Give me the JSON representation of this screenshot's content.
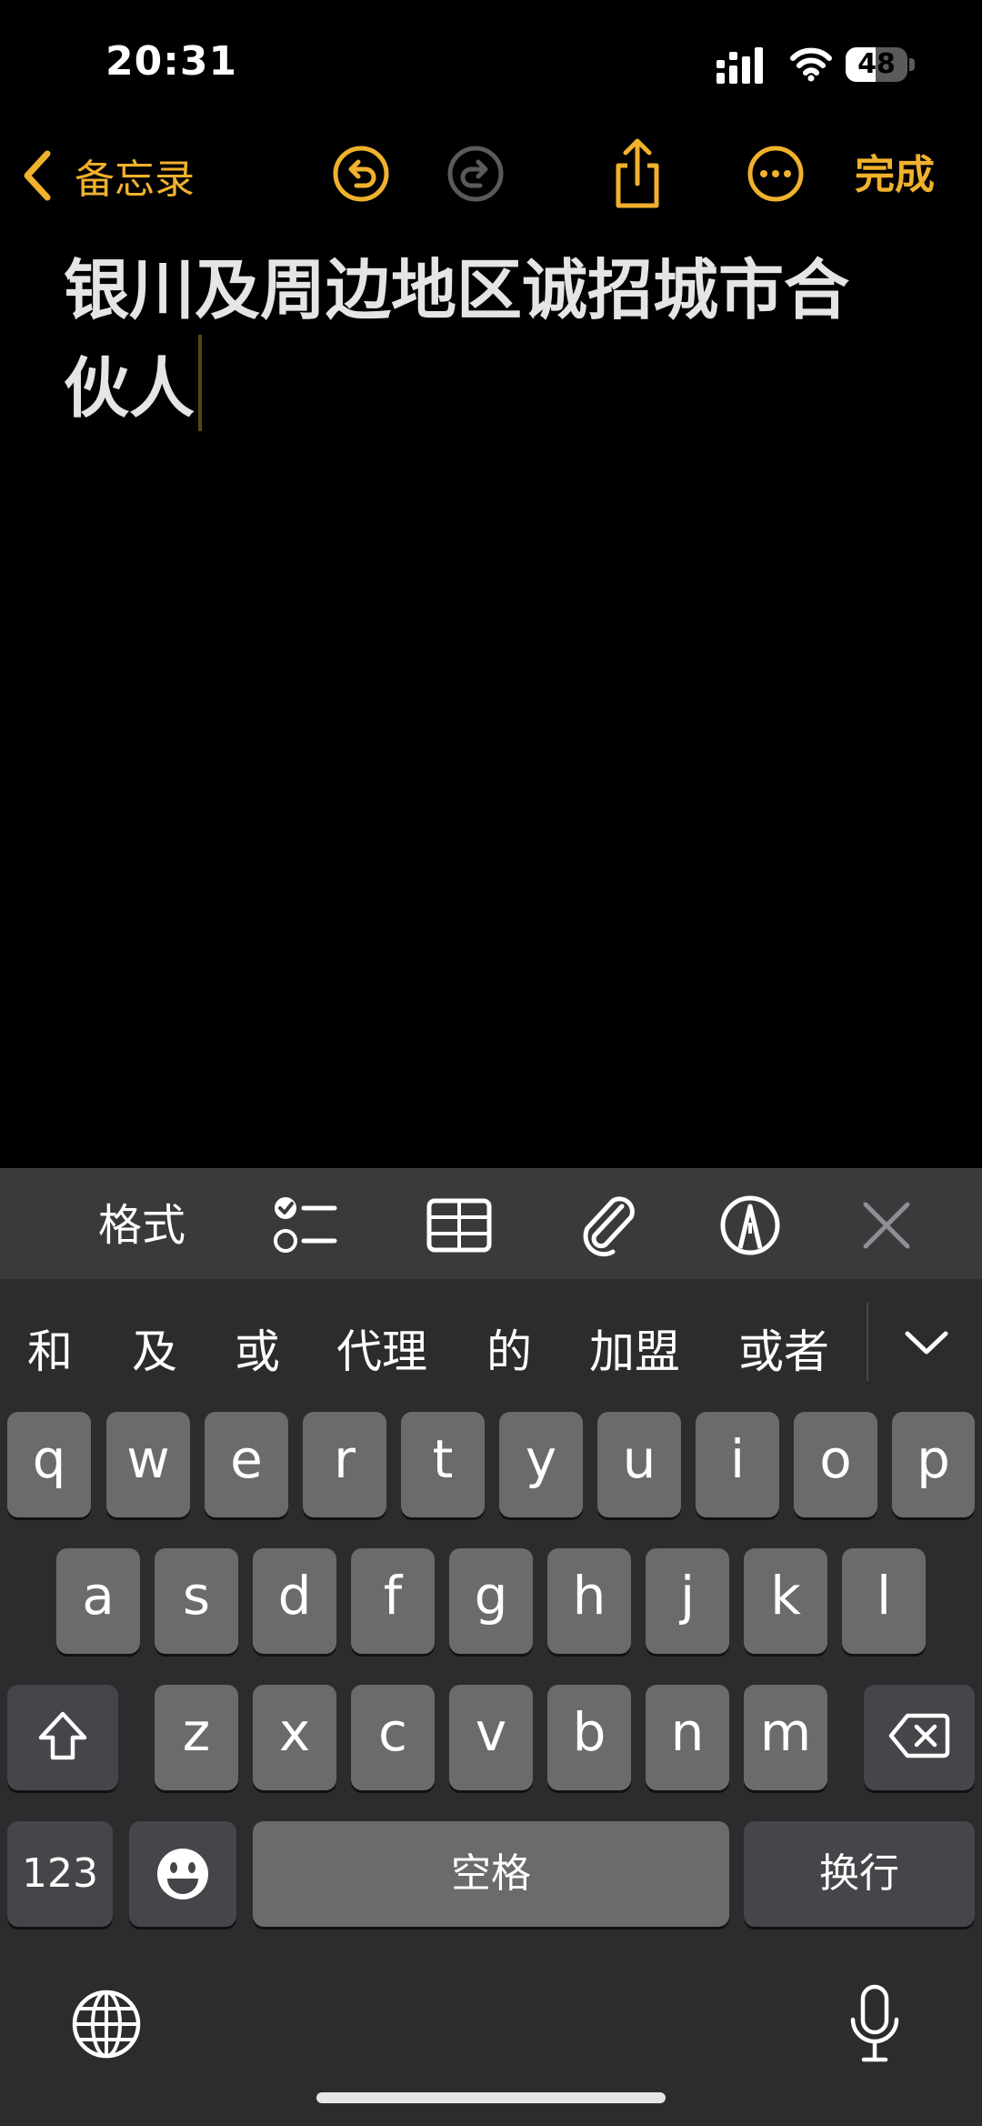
{
  "status": {
    "time": "20:31",
    "battery": "48",
    "battery_level": 0.48
  },
  "nav": {
    "back_label": "备忘录",
    "done_label": "完成",
    "icons": [
      "chevron-left-icon",
      "undo-icon",
      "redo-icon",
      "share-icon",
      "more-icon"
    ]
  },
  "note": {
    "line1": "银川及周边地区诚招城市合",
    "line2": "伙人"
  },
  "format_bar": {
    "format_label": "格式",
    "icons": [
      "checklist-icon",
      "table-icon",
      "paperclip-icon",
      "markup-pen-icon",
      "close-icon"
    ]
  },
  "candidates": [
    "和",
    "及",
    "或",
    "代理",
    "的",
    "加盟",
    "或者"
  ],
  "keyboard": {
    "row1": [
      "q",
      "w",
      "e",
      "r",
      "t",
      "y",
      "u",
      "i",
      "o",
      "p"
    ],
    "row2": [
      "a",
      "s",
      "d",
      "f",
      "g",
      "h",
      "j",
      "k",
      "l"
    ],
    "row3": [
      "z",
      "x",
      "c",
      "v",
      "b",
      "n",
      "m"
    ],
    "numbers_label": "123",
    "space_label": "空格",
    "return_label": "换行",
    "icons": [
      "shift-icon",
      "delete-icon",
      "emoji-icon",
      "globe-icon",
      "microphone-icon",
      "chevron-down-icon"
    ]
  },
  "colors": {
    "accent": "#f0b12d",
    "keyboard_bg": "#2c2c2e",
    "key": "#6b6b6e",
    "key_dark": "#46464a"
  }
}
